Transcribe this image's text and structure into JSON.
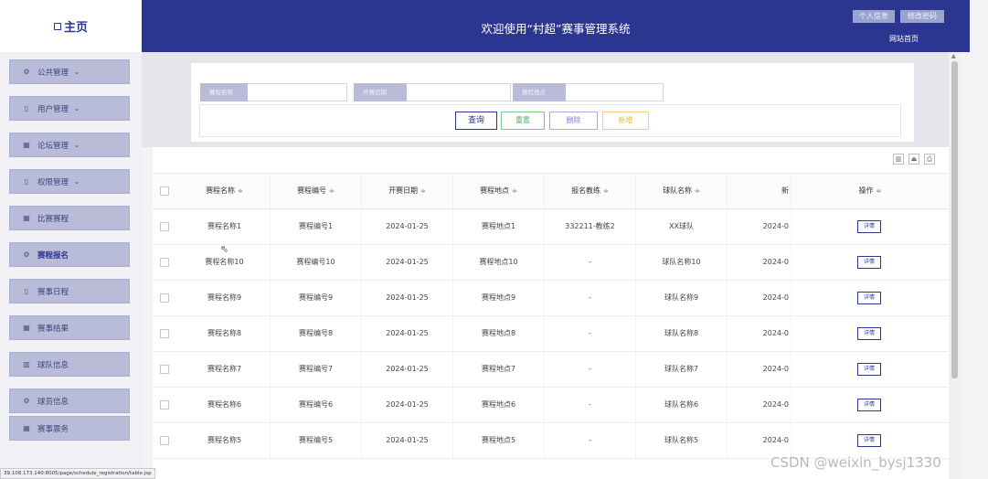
{
  "header": {
    "home_label": "主页",
    "title": "欢迎使用“村超”赛事管理系统",
    "profile_btn": "个人信息",
    "change_pw_btn": "修改密码",
    "site_home_link": "网站首页",
    "brand_color": "#2a3690"
  },
  "sidebar": {
    "items": [
      {
        "label": "公共管理",
        "icon": "gear-icon",
        "expandable": true
      },
      {
        "label": "用户管理",
        "icon": "doc-icon",
        "expandable": true
      },
      {
        "label": "论坛管理",
        "icon": "grid-icon",
        "expandable": true
      },
      {
        "label": "权限管理",
        "icon": "doc-icon",
        "expandable": true
      },
      {
        "label": "比赛赛程",
        "icon": "grid-icon",
        "expandable": false
      },
      {
        "label": "赛程报名",
        "icon": "gear-icon",
        "expandable": false,
        "active": true
      },
      {
        "label": "赛事日程",
        "icon": "doc-icon",
        "expandable": false
      },
      {
        "label": "赛事结果",
        "icon": "grid-icon",
        "expandable": false
      },
      {
        "label": "球队信息",
        "icon": "building-icon",
        "expandable": false
      },
      {
        "label": "球员信息",
        "icon": "gear-icon",
        "expandable": false
      },
      {
        "label": "赛事票务",
        "icon": "grid-icon",
        "expandable": false
      }
    ]
  },
  "search": {
    "name_label": "赛程名称",
    "name_value": "",
    "date_label": "开赛日期",
    "date_value": "",
    "location_label": "赛程地点",
    "location_value": "",
    "query_btn": "查询",
    "reset_btn": "重置",
    "delete_btn": "删除",
    "add_btn": "新增"
  },
  "table": {
    "columns": [
      "赛程名称",
      "赛程编号",
      "开赛日期",
      "赛程地点",
      "报名教练",
      "球队名称",
      "新",
      "操作"
    ],
    "sort_glyph": "≑",
    "detail_btn": "详情",
    "rows": [
      [
        "赛程名称1",
        "赛程编号1",
        "2024-01-25",
        "赛程地点1",
        "332211-教练2",
        "XX球队",
        "2024-0"
      ],
      [
        "赛程名称10",
        "赛程编号10",
        "2024-01-25",
        "赛程地点10",
        "-",
        "球队名称10",
        "2024-0"
      ],
      [
        "赛程名称9",
        "赛程编号9",
        "2024-01-25",
        "赛程地点9",
        "-",
        "球队名称9",
        "2024-0"
      ],
      [
        "赛程名称8",
        "赛程编号8",
        "2024-01-25",
        "赛程地点8",
        "-",
        "球队名称8",
        "2024-0"
      ],
      [
        "赛程名称7",
        "赛程编号7",
        "2024-01-25",
        "赛程地点7",
        "-",
        "球队名称7",
        "2024-0"
      ],
      [
        "赛程名称6",
        "赛程编号6",
        "2024-01-25",
        "赛程地点6",
        "-",
        "球队名称6",
        "2024-0"
      ],
      [
        "赛程名称5",
        "赛程编号5",
        "2024-01-25",
        "赛程地点5",
        "-",
        "球队名称5",
        "2024-0"
      ]
    ]
  },
  "status_url": "39.108.173.140:8005/page/schedule_registration/table.jsp",
  "watermark": "CSDN @weixin_bysj1330"
}
